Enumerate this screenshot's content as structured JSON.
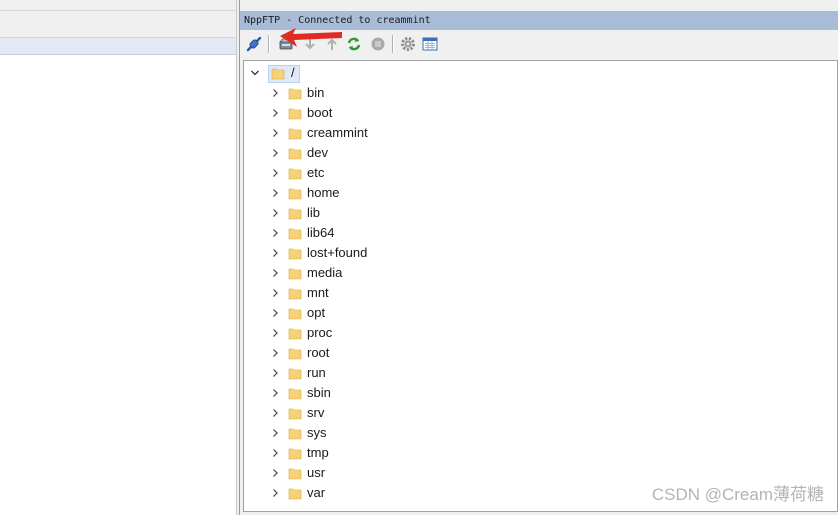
{
  "panel": {
    "title": "NppFTP - Connected to creammint"
  },
  "toolbar": {
    "buttons": [
      {
        "icon": "connect-icon",
        "enabled": true
      },
      {
        "icon": "refresh-server-icon",
        "enabled": true
      },
      {
        "icon": "download-icon",
        "enabled": false
      },
      {
        "icon": "upload-icon",
        "enabled": false
      },
      {
        "icon": "refresh-icon",
        "enabled": true
      },
      {
        "icon": "abort-icon",
        "enabled": false
      },
      {
        "icon": "settings-icon",
        "enabled": true
      },
      {
        "icon": "message-window-icon",
        "enabled": true
      }
    ]
  },
  "tree": {
    "root": "/",
    "folders": [
      "bin",
      "boot",
      "creammint",
      "dev",
      "etc",
      "home",
      "lib",
      "lib64",
      "lost+found",
      "media",
      "mnt",
      "opt",
      "proc",
      "root",
      "run",
      "sbin",
      "srv",
      "sys",
      "tmp",
      "usr",
      "var"
    ]
  },
  "watermark": "CSDN @Cream薄荷糖",
  "colors": {
    "title_bar": "#a9bcd7",
    "folder": "#f6d37a",
    "arrow": "#e02a22"
  }
}
